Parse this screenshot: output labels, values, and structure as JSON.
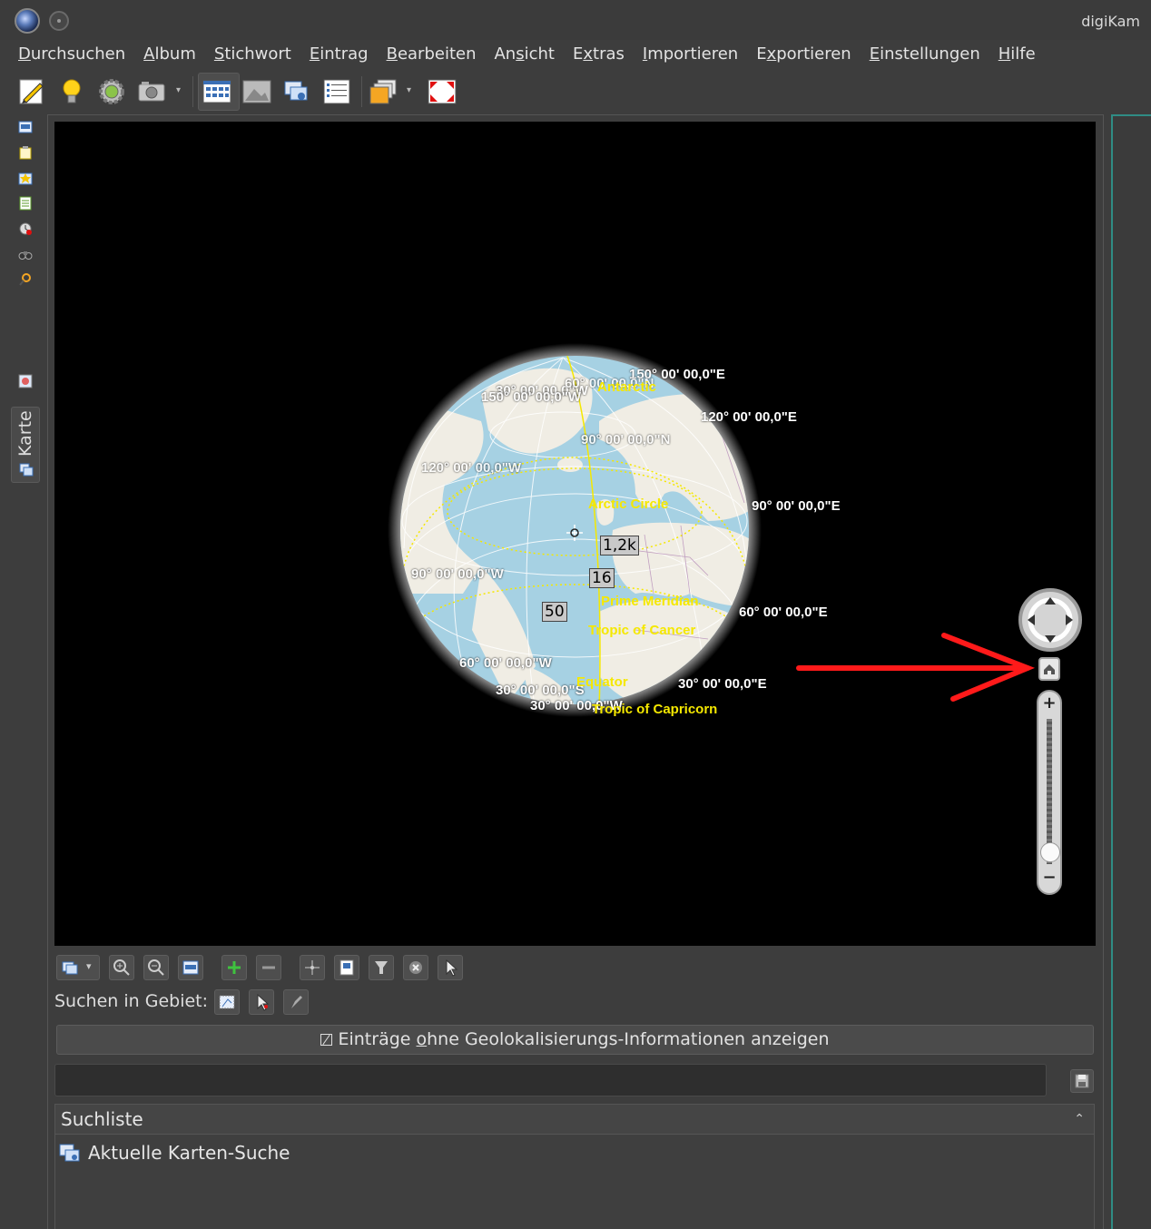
{
  "window": {
    "title": "digiKam"
  },
  "menu": [
    {
      "pre": "",
      "u": "D",
      "post": "urchsuchen"
    },
    {
      "pre": "",
      "u": "A",
      "post": "lbum"
    },
    {
      "pre": "",
      "u": "S",
      "post": "tichwort"
    },
    {
      "pre": "",
      "u": "E",
      "post": "intrag"
    },
    {
      "pre": "",
      "u": "B",
      "post": "earbeiten"
    },
    {
      "pre": "An",
      "u": "s",
      "post": "icht"
    },
    {
      "pre": "E",
      "u": "x",
      "post": "tras"
    },
    {
      "pre": "",
      "u": "I",
      "post": "mportieren"
    },
    {
      "pre": "E",
      "u": "x",
      "post": "portieren"
    },
    {
      "pre": "",
      "u": "E",
      "post": "instellungen"
    },
    {
      "pre": "",
      "u": "H",
      "post": "ilfe"
    }
  ],
  "sidebar": {
    "active_tab": "Karte"
  },
  "map": {
    "coords_white": [
      "150° 00' 00,0\"E",
      "120° 00' 00,0\"E",
      "90° 00' 00,0\"E",
      "60° 00' 00,0\"E",
      "30° 00' 00,0\"E",
      "30° 00' 00,0\"W",
      "150° 00' 00,0\"W",
      "90° 00' 00,0\"N",
      "120° 00' 00,0\"W",
      "90° 00' 00,0\"W",
      "60° 00' 00,0\"W",
      "30° 00' 00,0\"S",
      "30° 00' 00,0\"W",
      "60° 00' 00,0\"N"
    ],
    "coords_yellow": [
      "Arctic Circle",
      "Prime Meridian",
      "Tropic of Cancer",
      "Equator",
      "Tropic of Capricorn",
      "Antarctic"
    ],
    "clusters": [
      "1,2k",
      "16",
      "50"
    ],
    "colors": {
      "ocean": "#a6d1e3",
      "land": "#f0ede4",
      "arrow": "#ff1a1a",
      "label_yellow": "#f5e800"
    }
  },
  "search": {
    "area_label": "Suchen in Gebiet:",
    "show_no_geo": {
      "pre": "Einträge ",
      "u": "o",
      "post": "hne Geolokalisierungs-Informationen anzeigen"
    },
    "input_value": "",
    "list_title": "Suchliste",
    "list_items": [
      "Aktuelle Karten-Suche"
    ]
  }
}
